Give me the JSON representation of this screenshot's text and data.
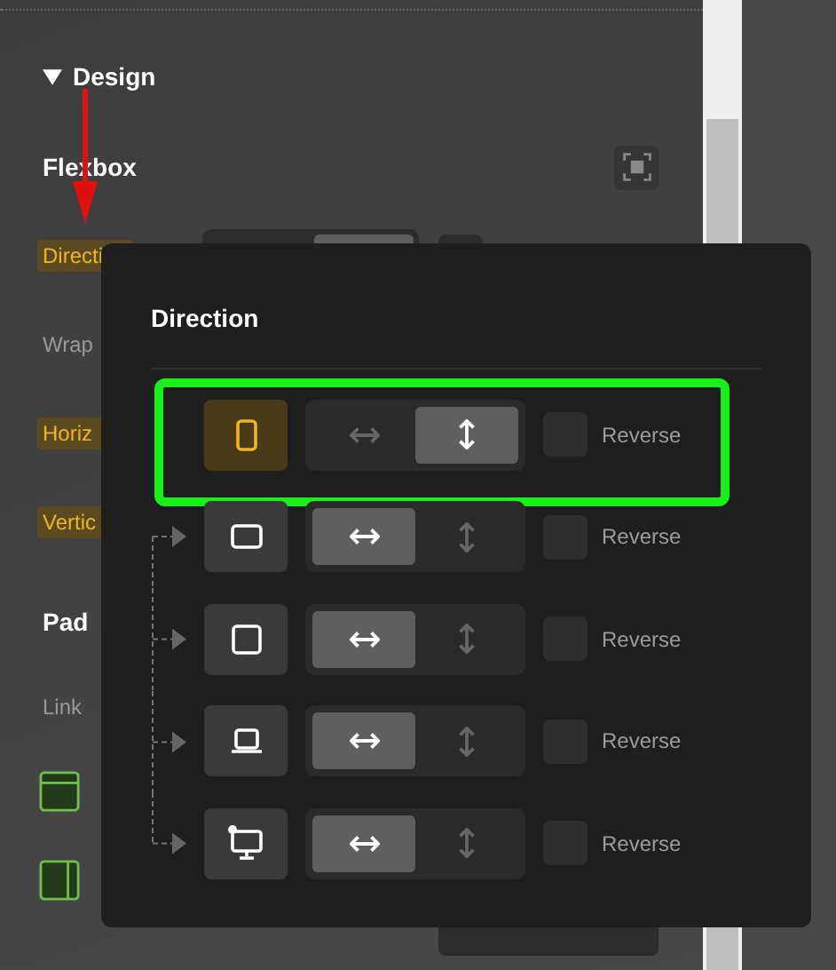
{
  "panel": {
    "section": {
      "title": "Design",
      "expanded": true
    },
    "subsection": "Flexbox",
    "labels": [
      {
        "text": "Directi",
        "highlighted": true
      },
      {
        "text": "Wrap",
        "highlighted": false
      },
      {
        "text": "Horiz",
        "highlighted": true
      },
      {
        "text": "Vertic",
        "highlighted": true
      }
    ],
    "direction_control": {
      "vertical": true,
      "reverse": false
    },
    "subsection_2": "Pad",
    "link_label": "Link"
  },
  "popup": {
    "title": "Direction",
    "base": {
      "kind": "phone-portrait",
      "selected": true,
      "vertical": true,
      "reverse": false,
      "reverse_label": "Reverse",
      "highlighted": true,
      "children": [
        {
          "kind": "phone-landscape",
          "selected": false,
          "vertical": false,
          "reverse": false,
          "reverse_label": "Reverse"
        },
        {
          "kind": "tablet",
          "selected": false,
          "vertical": false,
          "reverse": false,
          "reverse_label": "Reverse"
        },
        {
          "kind": "laptop",
          "selected": false,
          "vertical": false,
          "reverse": false,
          "reverse_label": "Reverse"
        },
        {
          "kind": "desktop",
          "selected": false,
          "vertical": false,
          "reverse": false,
          "reverse_label": "Reverse"
        }
      ]
    }
  }
}
